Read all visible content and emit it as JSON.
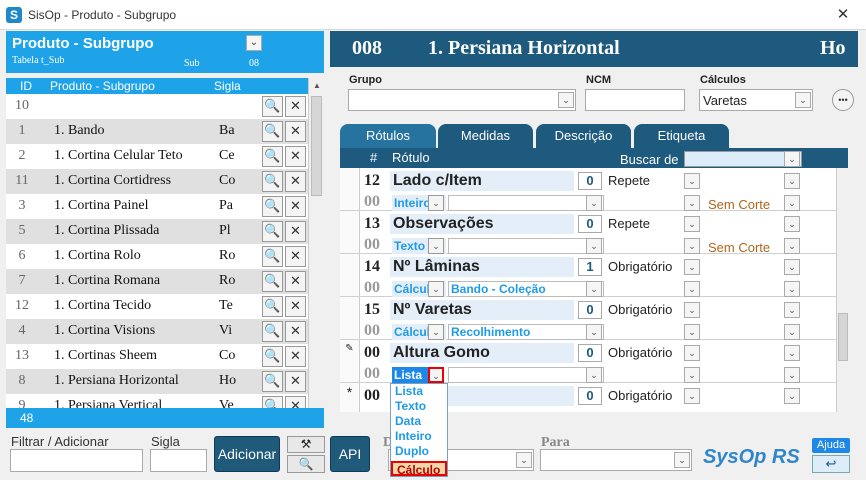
{
  "window": {
    "title": "SisOp - Produto - Subgrupo",
    "close": "✕"
  },
  "left_panel": {
    "title": "Produto - Subgrupo",
    "table_label": "Tabela t_Sub",
    "sub_label": "Sub",
    "sub_number": "08",
    "columns": [
      "ID",
      "Produto - Subgrupo",
      "Sigla"
    ],
    "input_row_id": "10",
    "rows": [
      {
        "id": "1",
        "name": "1. Bando",
        "sigla": "Ba"
      },
      {
        "id": "2",
        "name": "1. Cortina Celular Teto",
        "sigla": "Ce"
      },
      {
        "id": "11",
        "name": "1. Cortina Cortidress",
        "sigla": "Co"
      },
      {
        "id": "3",
        "name": "1. Cortina Painel",
        "sigla": "Pa"
      },
      {
        "id": "5",
        "name": "1. Cortina Plissada",
        "sigla": "Pl"
      },
      {
        "id": "6",
        "name": "1. Cortina Rolo",
        "sigla": "Ro"
      },
      {
        "id": "7",
        "name": "1. Cortina Romana",
        "sigla": "Ro"
      },
      {
        "id": "12",
        "name": "1. Cortina Tecido",
        "sigla": "Te"
      },
      {
        "id": "4",
        "name": "1. Cortina Visions",
        "sigla": "Vi"
      },
      {
        "id": "13",
        "name": "1. Cortinas Sheem",
        "sigla": "Co"
      },
      {
        "id": "8",
        "name": "1. Persiana Horizontal",
        "sigla": "Ho"
      },
      {
        "id": "9",
        "name": "1. Persiana Vertical",
        "sigla": "Ve"
      }
    ],
    "footer_count": "48",
    "filter_label": "Filtrar / Adicionar",
    "sigla_label": "Sigla",
    "add_button": "Adicionar",
    "api_button": "API"
  },
  "right_panel": {
    "id": "008",
    "title": "1. Persiana Horizontal",
    "code": "Ho",
    "grupo_label": "Grupo",
    "ncm_label": "NCM",
    "calculos_label": "Cálculos",
    "calculos_value": "Varetas",
    "more": "•••",
    "tabs": [
      "Rótulos",
      "Medidas",
      "Descrição",
      "Etiqueta"
    ],
    "grid": {
      "col_num": "#",
      "col_label": "Rótulo",
      "search_label": "Buscar de",
      "records": [
        {
          "num": "12",
          "num2": "00",
          "label": "Lado c/Item",
          "count": "0",
          "option": "Repete",
          "type": "Inteiro",
          "ref": "",
          "extra": "Sem Corte"
        },
        {
          "num": "13",
          "num2": "00",
          "label": "Observações",
          "count": "0",
          "option": "Repete",
          "type": "Texto",
          "ref": "",
          "extra": "Sem Corte"
        },
        {
          "num": "14",
          "num2": "00",
          "label": "Nº Lâminas",
          "count": "1",
          "option": "Obrigatório",
          "type": "Cálculo",
          "ref": "Bando - Coleção",
          "extra": ""
        },
        {
          "num": "15",
          "num2": "00",
          "label": "Nº Varetas",
          "count": "0",
          "option": "Obrigatório",
          "type": "Cálculo",
          "ref": "Recolhimento",
          "extra": ""
        },
        {
          "num": "00",
          "num2": "00",
          "label": "Altura Gomo",
          "count": "0",
          "option": "Obrigatório",
          "type": "Lista",
          "ref": "",
          "extra": ""
        },
        {
          "num": "00",
          "num2": "",
          "label": "",
          "count": "0",
          "option": "Obrigatório",
          "type": "",
          "ref": "",
          "extra": ""
        }
      ]
    },
    "dropdown_options": [
      "Lista",
      "Texto",
      "Data",
      "Inteiro",
      "Duplo",
      "Cálculo"
    ],
    "bottom_label_d": "D",
    "para_label": "Para",
    "brand": "SysOp RS",
    "help": "Ajuda"
  }
}
